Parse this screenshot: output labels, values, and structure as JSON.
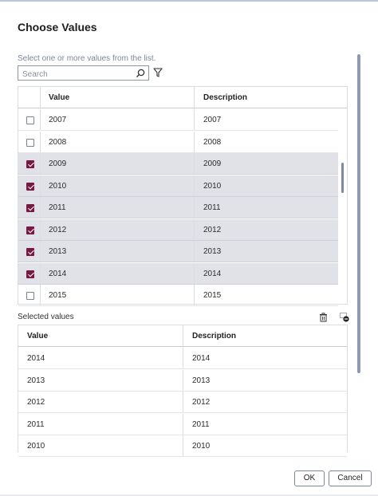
{
  "dialog": {
    "title": "Choose Values",
    "instruction": "Select one or more values from the list."
  },
  "search": {
    "placeholder": "Search"
  },
  "values_table": {
    "headers": {
      "value": "Value",
      "description": "Description"
    },
    "rows": [
      {
        "value": "2007",
        "description": "2007",
        "checked": false
      },
      {
        "value": "2008",
        "description": "2008",
        "checked": false
      },
      {
        "value": "2009",
        "description": "2009",
        "checked": true
      },
      {
        "value": "2010",
        "description": "2010",
        "checked": true
      },
      {
        "value": "2011",
        "description": "2011",
        "checked": true
      },
      {
        "value": "2012",
        "description": "2012",
        "checked": true
      },
      {
        "value": "2013",
        "description": "2013",
        "checked": true
      },
      {
        "value": "2014",
        "description": "2014",
        "checked": true
      },
      {
        "value": "2015",
        "description": "2015",
        "checked": false
      }
    ]
  },
  "selected_section": {
    "label": "Selected values",
    "headers": {
      "value": "Value",
      "description": "Description"
    },
    "rows": [
      {
        "value": "2014",
        "description": "2014"
      },
      {
        "value": "2013",
        "description": "2013"
      },
      {
        "value": "2012",
        "description": "2012"
      },
      {
        "value": "2011",
        "description": "2011"
      },
      {
        "value": "2010",
        "description": "2010"
      }
    ]
  },
  "buttons": {
    "ok": "OK",
    "cancel": "Cancel"
  },
  "colors": {
    "accent": "#7a1844",
    "selected_row": "#e1e2e8",
    "border": "#dadde2"
  },
  "icons": [
    "search-icon",
    "filter-icon",
    "trash-icon",
    "collapse-icon"
  ]
}
